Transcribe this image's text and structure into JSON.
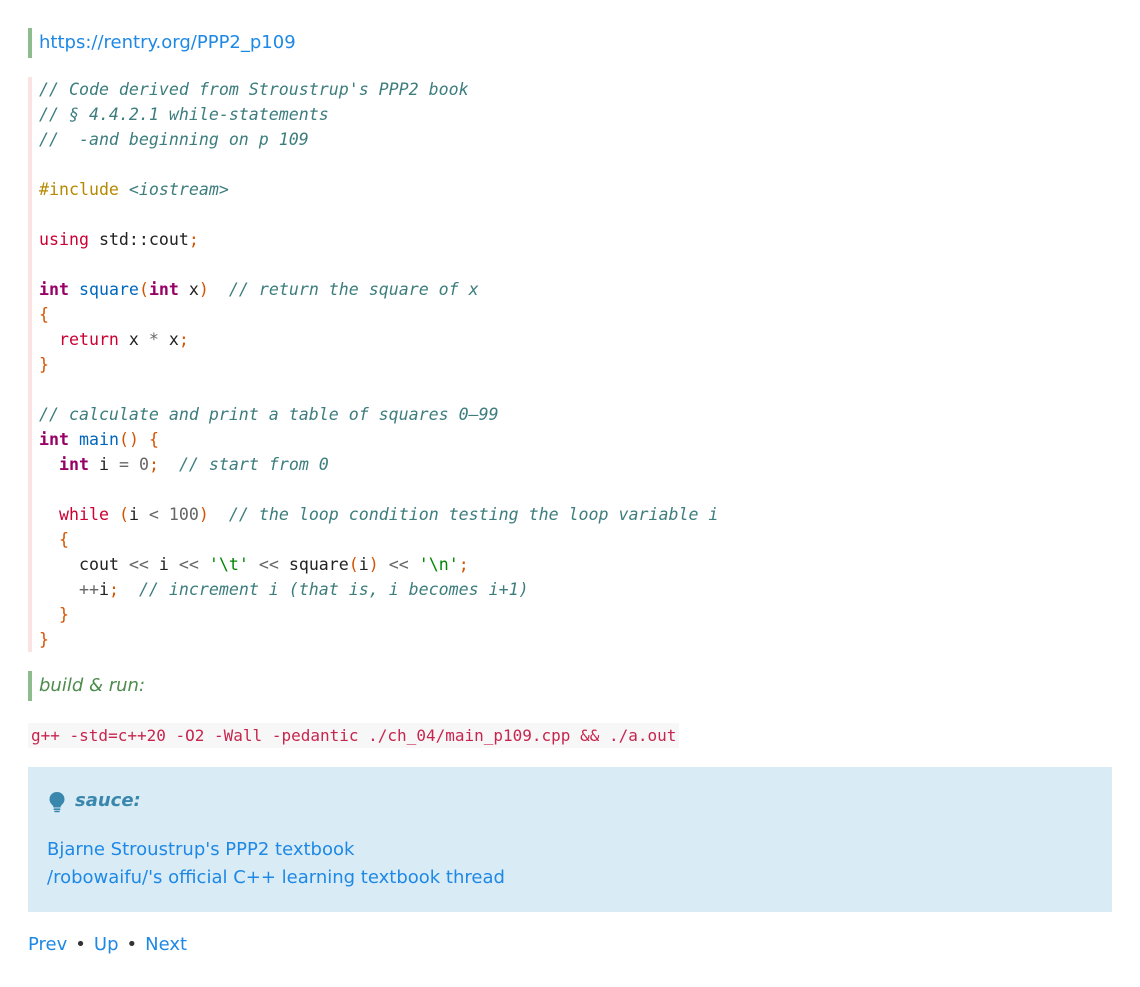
{
  "top_link": {
    "text": "https://rentry.org/PPP2_p109"
  },
  "code": {
    "l1": "// Code derived from Stroustrup's PPP2 book",
    "l2": "// § 4.4.2.1 while-statements",
    "l3": "//  -and beginning on p 109",
    "include_directive": "#include ",
    "include_header": "<iostream>",
    "using_kw": "using",
    "using_rest": "std::cout",
    "sq_int": "int",
    "sq_name": "square",
    "sq_param_type": "int",
    "sq_param": " x",
    "sq_comment": "// return the square of x",
    "open_brace": "{",
    "return_kw": "return",
    "return_expr": " x ",
    "mul_op": "*",
    "return_x": " x",
    "close_brace": "}",
    "calc_comment": "// calculate and print a table of squares 0–99",
    "main_int": "int",
    "main_name": "main",
    "decl_int": "int",
    "decl_var": " i ",
    "decl_eq": "=",
    "decl_val": "0",
    "decl_comment": "// start from 0",
    "while_kw": "while",
    "while_var": "i ",
    "while_op": "<",
    "while_limit": "100",
    "while_comment": "// the loop condition testing the loop variable i",
    "cout_name": "cout",
    "cout_op1": "<<",
    "cout_i": " i ",
    "cout_op2": "<<",
    "cout_tab": "'\\t'",
    "cout_op3": "<<",
    "cout_sq": " square",
    "cout_arg": "i",
    "cout_op4": "<<",
    "cout_nl": "'\\n'",
    "inc_op": "++",
    "inc_var": "i",
    "inc_comment": "// increment i (that is, i becomes i+1)"
  },
  "build_label": "build & run:",
  "build_command": "g++ -std=c++20 -O2 -Wall -pedantic ./ch_04/main_p109.cpp && ./a.out",
  "tip": {
    "icon": "lightbulb-icon",
    "title": "sauce:",
    "links": [
      "Bjarne Stroustrup's PPP2 textbook",
      "/robowaifu/'s official C++ learning textbook thread"
    ]
  },
  "nav": {
    "prev": "Prev",
    "up": "Up",
    "next": "Next",
    "separator": "•"
  },
  "colors": {
    "link": "#1e88e5",
    "quote_border": "#8fbc8f",
    "code_border": "#fbe3e4",
    "tip_background": "#d9ecf6",
    "tip_title": "#3a87ad",
    "command_text": "#c7254e"
  }
}
